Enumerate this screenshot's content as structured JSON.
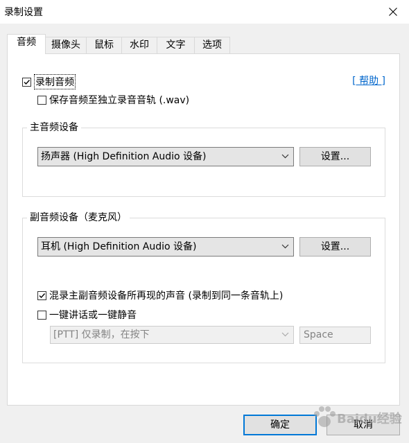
{
  "window": {
    "title": "录制设置"
  },
  "tabs": [
    {
      "label": "音频",
      "active": true
    },
    {
      "label": "摄像头"
    },
    {
      "label": "鼠标"
    },
    {
      "label": "水印"
    },
    {
      "label": "文字"
    },
    {
      "label": "选项"
    }
  ],
  "audio": {
    "record_audio": {
      "label": "录制音频",
      "checked": true
    },
    "save_separate": {
      "label": "保存音频至独立录音音轨 (.wav)",
      "checked": false
    },
    "help_link": "[ 帮助 ]"
  },
  "main_device": {
    "group_title": "主音频设备",
    "selected": "扬声器 (High Definition Audio 设备)",
    "settings_label": "设置..."
  },
  "sub_device": {
    "group_title": "副音频设备（麦克风）",
    "selected": "耳机 (High Definition Audio 设备)",
    "settings_label": "设置...",
    "mix": {
      "label": "混录主副音频设备所再现的声音 (录制到同一条音轨上)",
      "checked": true
    },
    "ptt": {
      "label": "一键讲话或一键静音",
      "checked": false
    },
    "ptt_mode": "[PTT] 仅录制，在按下",
    "hotkey": "Space"
  },
  "footer": {
    "ok_label": "确定",
    "cancel_label": "取消"
  },
  "watermark": {
    "text": "Baidu经验"
  }
}
